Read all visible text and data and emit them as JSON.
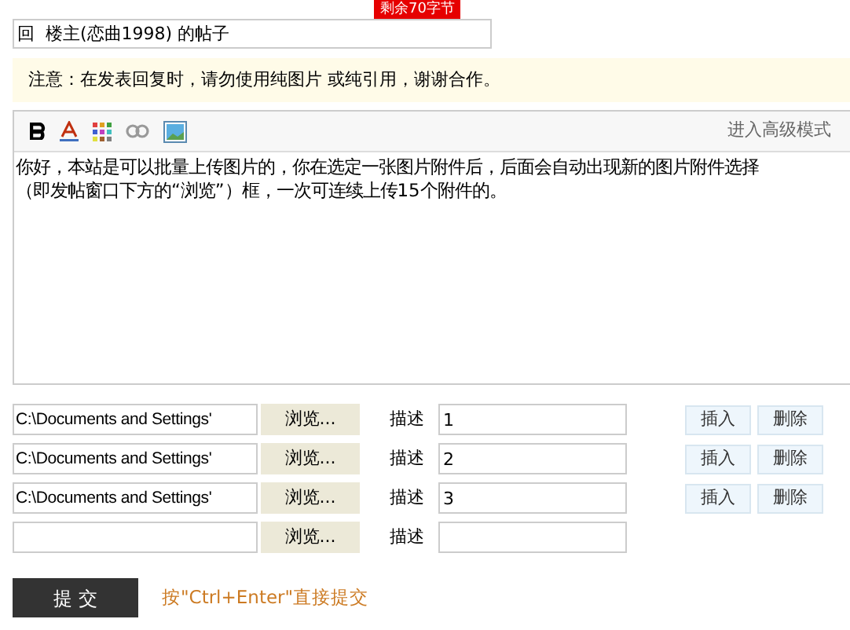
{
  "char_counter": "剩余70字节",
  "reply_title": {
    "value": "回  楼主(恋曲1998) 的帖子"
  },
  "notice": "注意：在发表回复时，请勿使用纯图片 或纯引用，谢谢合作。",
  "editor": {
    "advanced_mode_link": "进入高级模式",
    "body": "你好，本站是可以批量上传图片的，你在选定一张图片附件后，后面会自动出现新的图片附件选择（即发帖窗口下方的“浏览”）框，一次可连续上传15个附件的。"
  },
  "attachments": [
    {
      "path": "C:\\Documents and Settings'",
      "browse": "浏览...",
      "label": "描述",
      "description": "1",
      "actions": [
        "插入",
        "删除"
      ]
    },
    {
      "path": "C:\\Documents and Settings'",
      "browse": "浏览...",
      "label": "描述",
      "description": "2",
      "actions": [
        "插入",
        "删除"
      ]
    },
    {
      "path": "C:\\Documents and Settings'",
      "browse": "浏览...",
      "label": "描述",
      "description": "3",
      "actions": [
        "插入",
        "删除"
      ]
    },
    {
      "browse": "浏览...",
      "label": "描述"
    }
  ],
  "submit": {
    "label": "提 交",
    "hint": "按\"Ctrl+Enter\"直接提交"
  }
}
